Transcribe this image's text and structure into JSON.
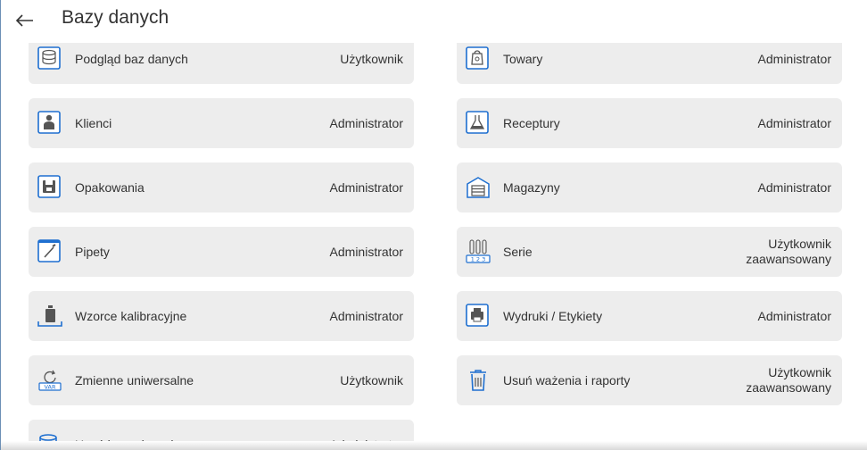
{
  "header": {
    "back_icon": "arrow-left-icon",
    "title": "Bazy danych"
  },
  "tiles": [
    {
      "label": "Podgląd baz danych",
      "role": "Użytkownik",
      "icon": "database-icon"
    },
    {
      "label": "Towary",
      "role": "Administrator",
      "icon": "product-bag-icon"
    },
    {
      "label": "Klienci",
      "role": "Administrator",
      "icon": "person-icon"
    },
    {
      "label": "Receptury",
      "role": "Administrator",
      "icon": "flask-icon"
    },
    {
      "label": "Opakowania",
      "role": "Administrator",
      "icon": "package-icon"
    },
    {
      "label": "Magazyny",
      "role": "Administrator",
      "icon": "warehouse-icon"
    },
    {
      "label": "Pipety",
      "role": "Administrator",
      "icon": "pipette-icon"
    },
    {
      "label": "Serie",
      "role": "Użytkownik\nzaawansowany",
      "icon": "series-tubes-icon"
    },
    {
      "label": "Wzorce kalibracyjne",
      "role": "Administrator",
      "icon": "calibration-weight-icon"
    },
    {
      "label": "Wydruki / Etykiety",
      "role": "Administrator",
      "icon": "printer-icon"
    },
    {
      "label": "Zmienne uniwersalne",
      "role": "Użytkownik",
      "icon": "universal-variables-icon"
    },
    {
      "label": "Usuń ważenia i raporty",
      "role": "Użytkownik\nzaawansowany",
      "icon": "trash-icon"
    },
    {
      "label": "Usuń bazy danych",
      "role": "Administrator",
      "icon": "delete-database-icon"
    }
  ],
  "colors": {
    "accent": "#1e6fd0",
    "tile_background": "#ededed",
    "text": "#333333"
  }
}
